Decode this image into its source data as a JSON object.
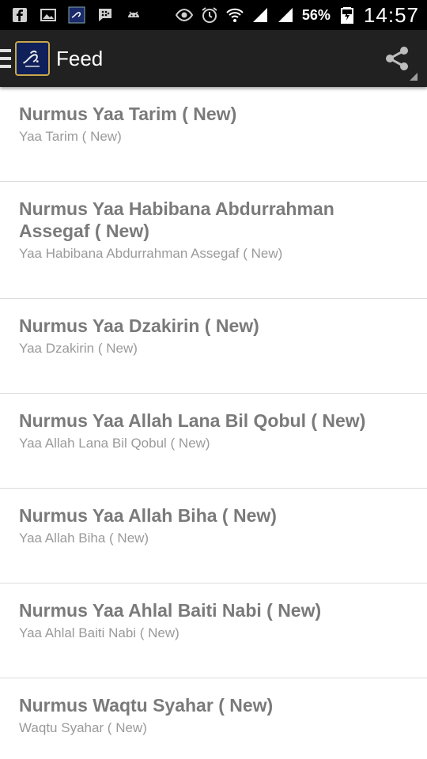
{
  "status_bar": {
    "left_icons": [
      "facebook-icon",
      "gallery-icon",
      "app-calligraphy-icon",
      "bbm-icon",
      "android-icon"
    ],
    "right_icons": [
      "eye-icon",
      "alarm-icon",
      "wifi-icon",
      "signal-icon",
      "signal-icon",
      "battery-icon"
    ],
    "battery": "56%",
    "time": "14:57"
  },
  "action_bar": {
    "title": "Feed",
    "icons": [
      "menu-icon",
      "app-logo",
      "share-icon"
    ]
  },
  "feed": {
    "items": [
      {
        "title": "Nurmus Yaa Tarim ( New)",
        "subtitle": "Yaa Tarim ( New)"
      },
      {
        "title": "Nurmus Yaa Habibana Abdurrahman Assegaf ( New)",
        "subtitle": "Yaa Habibana Abdurrahman Assegaf ( New)"
      },
      {
        "title": "Nurmus Yaa Dzakirin ( New)",
        "subtitle": "Yaa Dzakirin ( New)"
      },
      {
        "title": "Nurmus Yaa Allah Lana Bil Qobul ( New)",
        "subtitle": "Yaa Allah Lana Bil Qobul ( New)"
      },
      {
        "title": "Nurmus Yaa Allah Biha ( New)",
        "subtitle": "Yaa Allah Biha ( New)"
      },
      {
        "title": "Nurmus Yaa Ahlal Baiti Nabi ( New)",
        "subtitle": "Yaa Ahlal Baiti Nabi ( New)"
      },
      {
        "title": "Nurmus Waqtu Syahar ( New)",
        "subtitle": "Waqtu Syahar ( New)"
      }
    ]
  },
  "colors": {
    "status_bar": "#000000",
    "action_bar": "#212121",
    "title_text": "#7a7a7a",
    "subtitle_text": "#9a9a9a",
    "divider": "#dcdcdc",
    "logo_border": "#c9a84a",
    "logo_bg": "#10205a"
  }
}
